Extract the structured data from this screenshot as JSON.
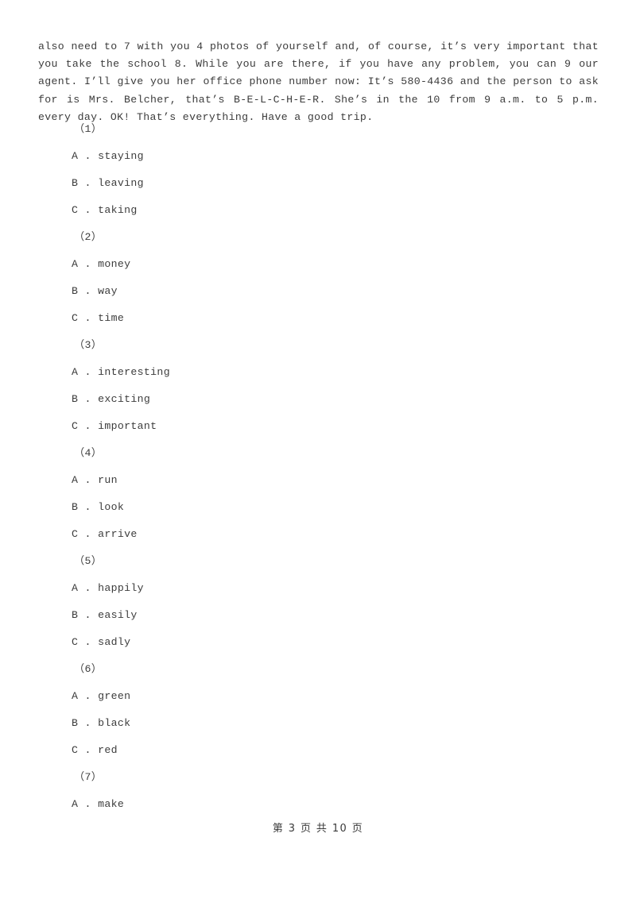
{
  "document": {
    "passage": "also need to 7 with you 4 photos of yourself and, of course, it’s very important that you take the school 8. While you are there, if you have any problem, you can 9 our agent. I’ll give you her office phone number now: It’s 580-4436 and the person to ask for is Mrs. Belcher, that’s B-E-L-C-H-E-R. She’s in the 10 from 9 a.m. to 5 p.m. every day. OK! That’s everything. Have a good trip.",
    "questions": [
      {
        "number": "（1）",
        "options": [
          {
            "label": "A",
            "separator": " . ",
            "text": "staying"
          },
          {
            "label": "B",
            "separator": " . ",
            "text": "leaving"
          },
          {
            "label": "C",
            "separator": " . ",
            "text": "taking"
          }
        ]
      },
      {
        "number": "（2）",
        "options": [
          {
            "label": "A",
            "separator": " . ",
            "text": "money"
          },
          {
            "label": "B",
            "separator": " . ",
            "text": "way"
          },
          {
            "label": "C",
            "separator": " . ",
            "text": "time"
          }
        ]
      },
      {
        "number": "（3）",
        "options": [
          {
            "label": "A",
            "separator": " . ",
            "text": "interesting"
          },
          {
            "label": "B",
            "separator": " . ",
            "text": "exciting"
          },
          {
            "label": "C",
            "separator": " . ",
            "text": "important"
          }
        ]
      },
      {
        "number": "（4）",
        "options": [
          {
            "label": "A",
            "separator": " . ",
            "text": "run"
          },
          {
            "label": "B",
            "separator": " . ",
            "text": "look"
          },
          {
            "label": "C",
            "separator": " . ",
            "text": "arrive"
          }
        ]
      },
      {
        "number": "（5）",
        "options": [
          {
            "label": "A",
            "separator": " . ",
            "text": "happily"
          },
          {
            "label": "B",
            "separator": " . ",
            "text": "easily"
          },
          {
            "label": "C",
            "separator": " . ",
            "text": "sadly"
          }
        ]
      },
      {
        "number": "（6）",
        "options": [
          {
            "label": "A",
            "separator": " . ",
            "text": "green"
          },
          {
            "label": "B",
            "separator": " . ",
            "text": "black"
          },
          {
            "label": "C",
            "separator": " . ",
            "text": "red"
          }
        ]
      },
      {
        "number": "（7）",
        "options": [
          {
            "label": "A",
            "separator": " . ",
            "text": "make"
          }
        ]
      }
    ],
    "footer": {
      "text": "第 3 页 共 10 页",
      "current_page": "3",
      "total_pages": "10"
    }
  },
  "colors": {
    "page_background": "#ffffff",
    "text": "#3c3c3c"
  }
}
